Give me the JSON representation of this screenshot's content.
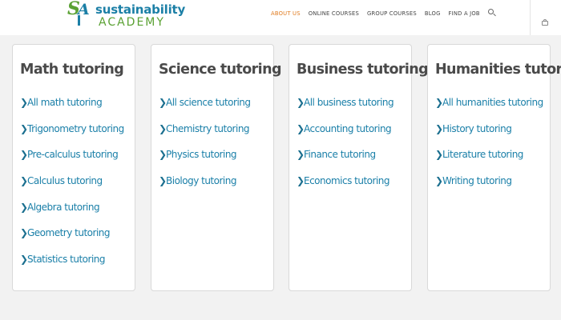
{
  "brand": {
    "mark_s": "S",
    "mark_a": "A",
    "line1": "sustainability",
    "line2": "ACADEMY"
  },
  "colors": {
    "accent_orange": "#e07b1f",
    "link_blue": "#1a7fa8",
    "brand_green": "#5aa133",
    "brand_blue": "#1b7fa6"
  },
  "nav": {
    "items": [
      {
        "label": "ABOUT US",
        "active": true
      },
      {
        "label": "ONLINE COURSES",
        "active": false
      },
      {
        "label": "GROUP COURSES",
        "active": false
      },
      {
        "label": "BLOG",
        "active": false
      },
      {
        "label": "FIND A JOB",
        "active": false
      }
    ],
    "search_icon": "search-icon",
    "cart_icon": "cart-icon"
  },
  "cards": [
    {
      "title": "Math tutoring",
      "links": [
        "All math tutoring",
        "Trigonometry tutoring",
        "Pre-calculus tutoring",
        "Calculus tutoring",
        "Algebra tutoring",
        "Geometry tutoring",
        "Statistics tutoring"
      ]
    },
    {
      "title": "Science tutoring",
      "links": [
        "All science tutoring",
        "Chemistry tutoring",
        "Physics tutoring",
        "Biology tutoring"
      ]
    },
    {
      "title": "Business tutoring",
      "links": [
        "All business tutoring",
        "Accounting tutoring",
        "Finance tutoring",
        "Economics tutoring"
      ]
    },
    {
      "title": "Humanities tutoring",
      "links": [
        "All humanities tutoring",
        "History tutoring",
        "Literature tutoring",
        "Writing tutoring"
      ]
    }
  ],
  "chevron_glyph": "❯"
}
